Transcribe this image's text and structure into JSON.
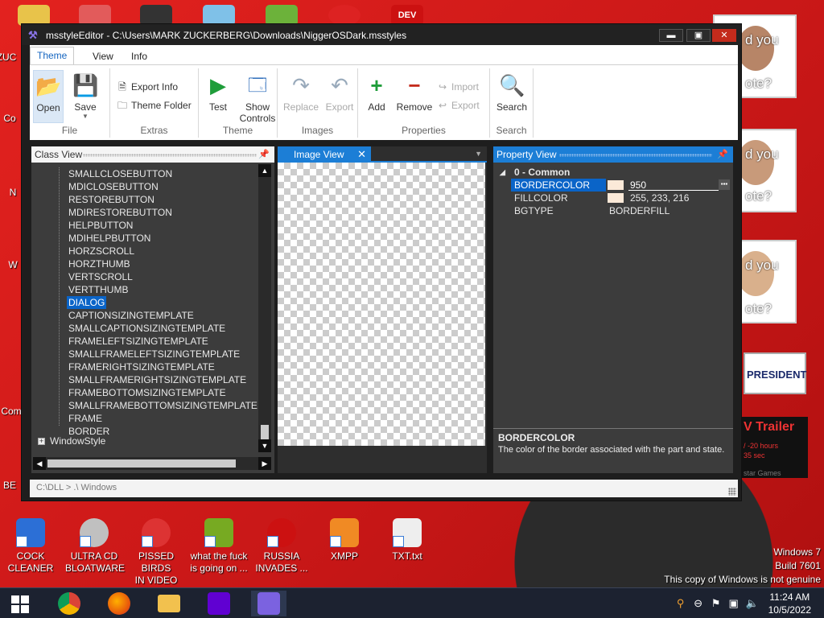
{
  "window": {
    "title": "msstyleEditor - C:\\Users\\MARK ZUCKERBERG\\Downloads\\NiggerOSDark.msstyles",
    "controls": {
      "minimize": "▬",
      "maximize": "▣",
      "close": "✕"
    }
  },
  "menu": {
    "tabs": [
      "Theme",
      "View",
      "Info"
    ],
    "active": "Theme"
  },
  "ribbon": {
    "file": {
      "label": "File",
      "open": "Open",
      "save": "Save"
    },
    "extras": {
      "label": "Extras",
      "export_info": "Export Info",
      "theme_folder": "Theme Folder"
    },
    "theme": {
      "label": "Theme",
      "test": "Test",
      "show_controls_1": "Show",
      "show_controls_2": "Controls"
    },
    "images": {
      "label": "Images",
      "replace": "Replace",
      "export": "Export"
    },
    "properties": {
      "label": "Properties",
      "add": "Add",
      "remove": "Remove",
      "import": "Import",
      "export": "Export"
    },
    "search": {
      "label": "Search",
      "search": "Search"
    }
  },
  "class_view": {
    "title": "Class View",
    "items": [
      "SMALLCLOSEBUTTON",
      "MDICLOSEBUTTON",
      "RESTOREBUTTON",
      "MDIRESTOREBUTTON",
      "HELPBUTTON",
      "MDIHELPBUTTON",
      "HORZSCROLL",
      "HORZTHUMB",
      "VERTSCROLL",
      "VERTTHUMB",
      "DIALOG",
      "CAPTIONSIZINGTEMPLATE",
      "SMALLCAPTIONSIZINGTEMPLATE",
      "FRAMELEFTSIZINGTEMPLATE",
      "SMALLFRAMELEFTSIZINGTEMPLATE",
      "FRAMERIGHTSIZINGTEMPLATE",
      "SMALLFRAMERIGHTSIZINGTEMPLATE",
      "FRAMEBOTTOMSIZINGTEMPLATE",
      "SMALLFRAMEBOTTOMSIZINGTEMPLATE",
      "FRAME",
      "BORDER"
    ],
    "selected": "DIALOG",
    "root": "WindowStyle",
    "expand_glyph": "+"
  },
  "image_view": {
    "title": "Image View",
    "close": "✕"
  },
  "property_view": {
    "title": "Property View",
    "group": "0 - Common",
    "rows": [
      {
        "name": "BORDERCOLOR",
        "value": "950"
      },
      {
        "name": "FILLCOLOR",
        "value": "255, 233, 216"
      },
      {
        "name": "BGTYPE",
        "value": "BORDERFILL"
      }
    ],
    "swatch_color": "#fbe9d8",
    "desc_title": "BORDERCOLOR",
    "desc_text": "The color of the border associated with the part and state."
  },
  "statusbar": {
    "text": "C:\\DLL > .\\ Windows"
  },
  "desktop": {
    "icons": [
      {
        "label1": "COCK",
        "label2": "CLEANER",
        "color": "#2c6fd6"
      },
      {
        "label1": "ULTRA CD",
        "label2": "BLOATWARE",
        "color": "#c0c0c0"
      },
      {
        "label1": "PISSED BIRDS",
        "label2": "IN VIDEO G...",
        "color": "#d33"
      },
      {
        "label1": "what the fuck",
        "label2": "is going on ...",
        "color": "#7a2"
      },
      {
        "label1": "RUSSIA",
        "label2": "INVADES ...",
        "color": "#c11"
      },
      {
        "label1": "XMPP",
        "label2": "",
        "color": "#f08a24"
      },
      {
        "label1": "TXT.txt",
        "label2": "",
        "color": "#eee"
      }
    ],
    "left_edge": [
      "ZUC",
      "Co",
      "N",
      "W",
      "Com",
      "BE"
    ],
    "ads": {
      "q1": "d you",
      "q1b": "ote?",
      "q2": "d you",
      "q2b": "ote?",
      "q3": "d you",
      "q3b": "ote?",
      "president": "PRESIDENT",
      "trailer": "V Trailer",
      "trailer_sub1": "/ -20 hours",
      "trailer_sub2": "35 sec",
      "trailer_sub3": "star Games"
    },
    "watermark": {
      "line1": "Windows 7",
      "line2": "Build 7601",
      "line3": "This copy of Windows is not genuine"
    }
  },
  "taskbar": {
    "time": "11:24 AM",
    "date": "10/5/2022"
  }
}
